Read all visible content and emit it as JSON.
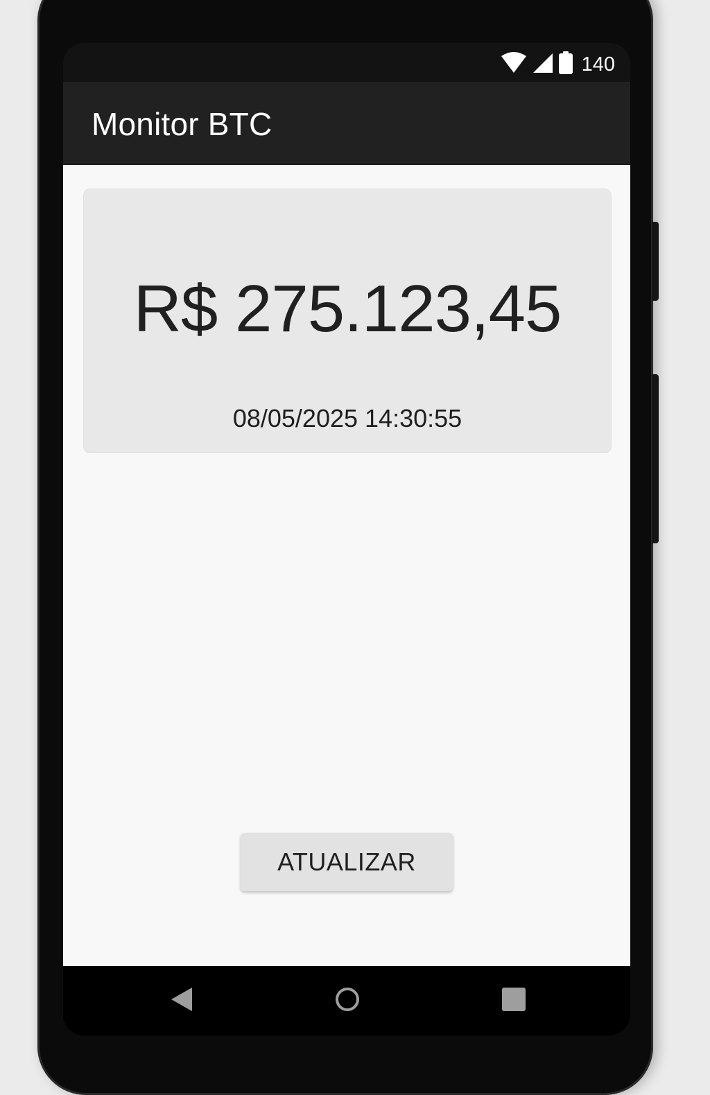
{
  "status_bar": {
    "battery_level": "140",
    "icons": [
      "wifi-icon",
      "cell-signal-icon",
      "battery-icon"
    ]
  },
  "app_bar": {
    "title": "Monitor BTC"
  },
  "price_card": {
    "price": "R$ 275.123,45",
    "timestamp": "08/05/2025 14:30:55"
  },
  "actions": {
    "update_label": "ATUALIZAR"
  },
  "nav_bar": {
    "icons": [
      "back-icon",
      "home-icon",
      "recents-icon"
    ]
  },
  "colors": {
    "app_bar": "#212121",
    "status_bar": "#131313",
    "background": "#f8f8f8",
    "card": "#e8e8e8",
    "button": "#e2e2e2",
    "text": "#202020"
  }
}
